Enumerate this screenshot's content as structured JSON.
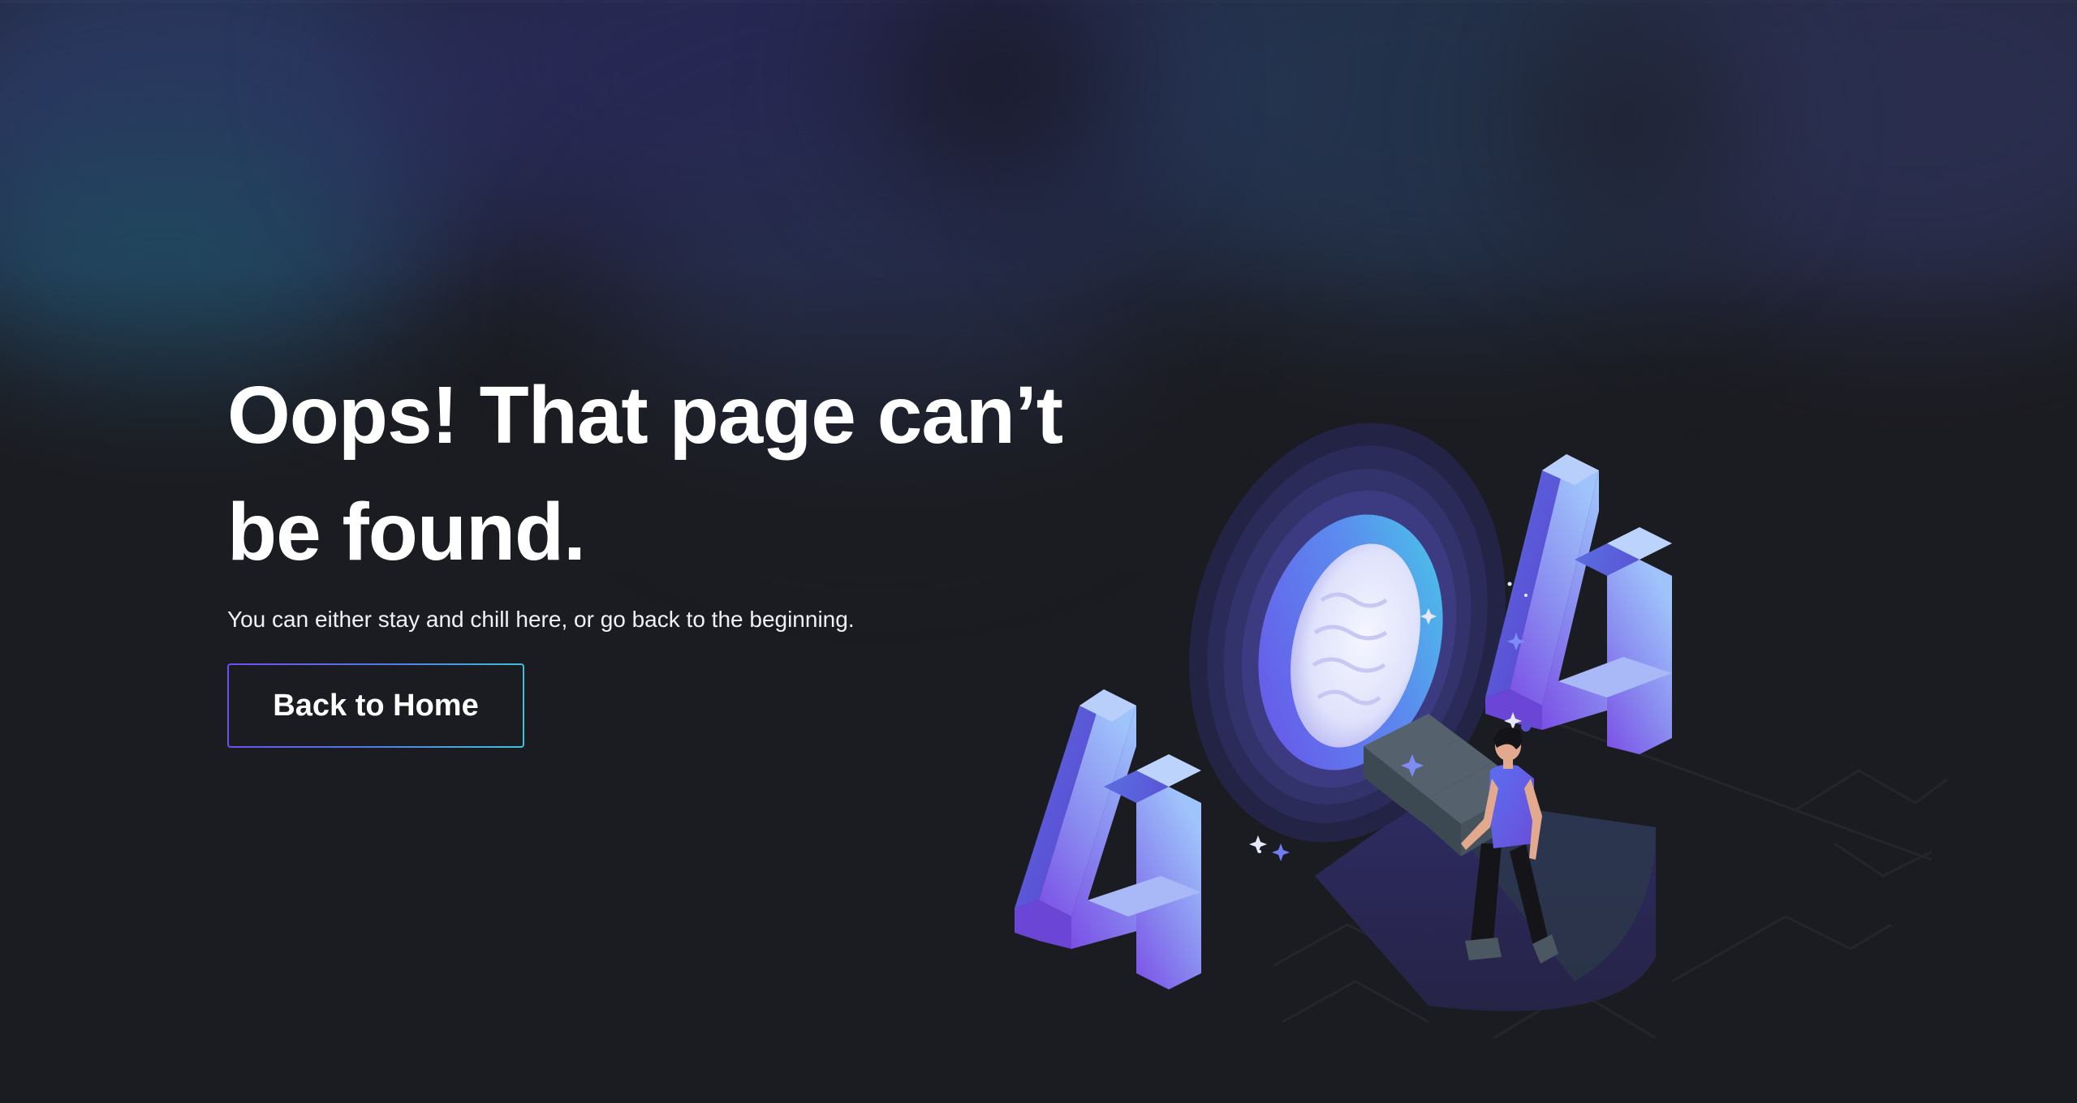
{
  "main": {
    "title": "Oops! That page can’t be found.",
    "subtitle": "You can either stay and chill here, or go back to the beginning.",
    "home_button_label": "Back to Home"
  },
  "illustration": {
    "digits": [
      "4",
      "0",
      "4"
    ]
  },
  "colors": {
    "background": "#1b1c21",
    "accent_purple": "#6b4ff0",
    "accent_blue": "#7fa6ff",
    "accent_cyan": "#3fc4d8",
    "text": "#ffffff"
  }
}
